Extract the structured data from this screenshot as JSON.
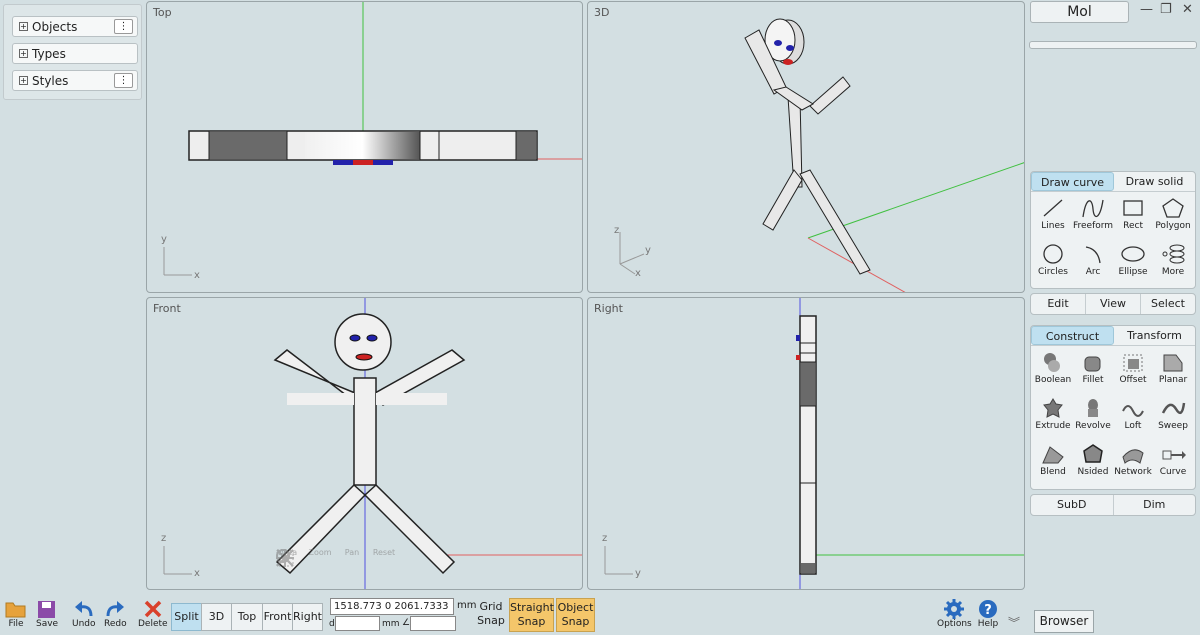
{
  "left_panel": {
    "items": [
      {
        "label": "Objects",
        "has_menu": true
      },
      {
        "label": "Types",
        "has_menu": false
      },
      {
        "label": "Styles",
        "has_menu": true
      }
    ]
  },
  "viewports": {
    "top": {
      "label": "Top",
      "axes": [
        "y",
        "x"
      ]
    },
    "threed": {
      "label": "3D",
      "axes": [
        "z",
        "y",
        "x"
      ]
    },
    "front": {
      "label": "Front",
      "axes": [
        "z",
        "x"
      ]
    },
    "right": {
      "label": "Right",
      "axes": [
        "z",
        "y"
      ]
    }
  },
  "view_controls": {
    "area": "Area",
    "zoom": "Zoom",
    "pan": "Pan",
    "reset": "Reset"
  },
  "app": {
    "title": "Mol"
  },
  "draw_panel": {
    "tabs": [
      "Draw curve",
      "Draw solid"
    ],
    "tools": [
      "Lines",
      "Freeform",
      "Rect",
      "Polygon",
      "Circles",
      "Arc",
      "Ellipse",
      "More"
    ]
  },
  "edit_row": [
    "Edit",
    "View",
    "Select"
  ],
  "construct_panel": {
    "tabs": [
      "Construct",
      "Transform"
    ],
    "tools": [
      "Boolean",
      "Fillet",
      "Offset",
      "Planar",
      "Extrude",
      "Revolve",
      "Loft",
      "Sweep",
      "Blend",
      "Nsided",
      "Network",
      "Curve"
    ]
  },
  "subd_row": [
    "SubD",
    "Dim"
  ],
  "toolbar": {
    "file": "File",
    "save": "Save",
    "undo": "Undo",
    "redo": "Redo",
    "delete": "Delete",
    "views": [
      "Split",
      "3D",
      "Top",
      "Front",
      "Right"
    ],
    "coords": "1518.773  0  2061.7333",
    "unit": "mm",
    "d_label": "d",
    "unit2": "mm",
    "angle": "∠",
    "grid_snap_1": "Grid",
    "grid_snap_2": "Snap",
    "straight_snap_1": "Straight",
    "straight_snap_2": "Snap",
    "object_snap_1": "Object",
    "object_snap_2": "Snap",
    "options": "Options",
    "help": "Help",
    "browser": "Browser"
  },
  "colors": {
    "accent": "#bfe0f0",
    "snap_on": "#f4c66a",
    "axis_x": "#e06060",
    "axis_y": "#40c040",
    "axis_z": "#5050e0"
  }
}
